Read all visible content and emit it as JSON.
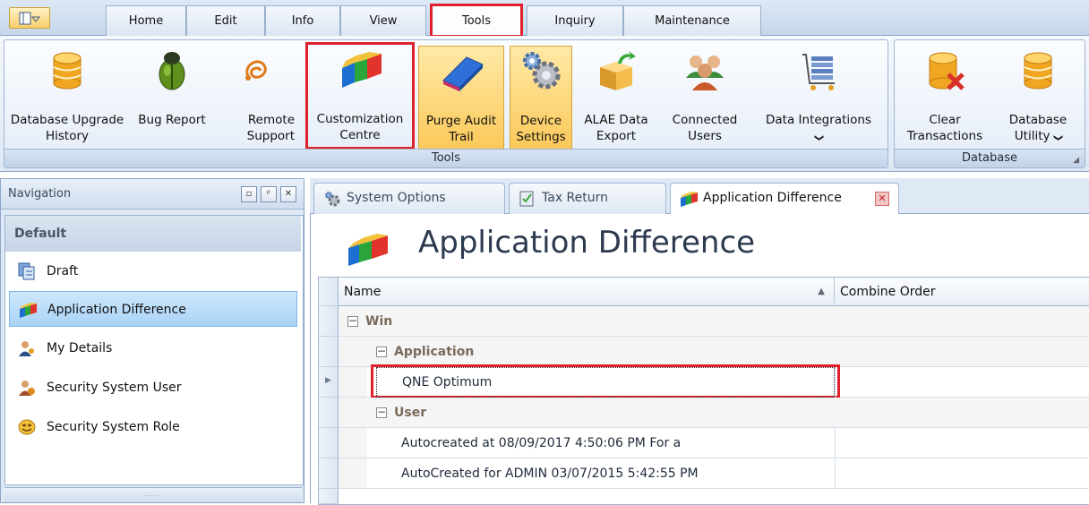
{
  "ribbon_tabs": [
    "Home",
    "Edit",
    "Info",
    "View",
    "Tools",
    "Inquiry",
    "Maintenance"
  ],
  "active_tab": "Tools",
  "tools_group": {
    "label": "Tools",
    "buttons": [
      {
        "label": "Database Upgrade History",
        "icon": "database-icon"
      },
      {
        "label": "Bug Report",
        "icon": "bug-icon"
      },
      {
        "label": "Remote Support",
        "icon": "remote-support-icon"
      },
      {
        "label": "Customization Centre",
        "icon": "customization-blocks-icon"
      },
      {
        "label": "Purge Audit Trail",
        "icon": "eraser-icon"
      },
      {
        "label": "Device Settings",
        "icon": "gears-icon"
      },
      {
        "label": "ALAE Data Export",
        "icon": "box-export-icon"
      },
      {
        "label": "Connected Users",
        "icon": "users-icon"
      },
      {
        "label": "Data Integrations",
        "icon": "cart-integration-icon",
        "dropdown": "❯"
      }
    ]
  },
  "database_group": {
    "label": "Database",
    "buttons": [
      {
        "label": "Clear Transactions",
        "icon": "database-clear-icon"
      },
      {
        "label": "Database Utility",
        "icon": "database-utility-icon",
        "dropdown": "❯"
      }
    ]
  },
  "navigation": {
    "title": "Navigation",
    "group": "Default",
    "items": [
      {
        "label": "Draft",
        "icon": "draft-icon"
      },
      {
        "label": "Application Difference",
        "icon": "customization-blocks-icon",
        "selected": true
      },
      {
        "label": "My Details",
        "icon": "user-icon"
      },
      {
        "label": "Security System User",
        "icon": "security-user-icon"
      },
      {
        "label": "Security System Role",
        "icon": "role-mask-icon"
      }
    ]
  },
  "doc_tabs": [
    {
      "label": "System Options",
      "icon": "gears-icon"
    },
    {
      "label": "Tax Return",
      "icon": "checklist-icon"
    },
    {
      "label": "Application Difference",
      "icon": "customization-blocks-icon",
      "active": true
    }
  ],
  "view": {
    "title": "Application Difference"
  },
  "grid": {
    "columns": [
      "Name",
      "Combine Order"
    ],
    "sort_glyph": "▲",
    "rows": [
      {
        "type": "group",
        "level": 0,
        "label": "Win"
      },
      {
        "type": "group",
        "level": 1,
        "label": "Application"
      },
      {
        "type": "data",
        "name": "QNE Optimum",
        "focused": true
      },
      {
        "type": "group",
        "level": 1,
        "label": "User"
      },
      {
        "type": "data",
        "name": "Autocreated at 08/09/2017 4:50:06 PM For a"
      },
      {
        "type": "data",
        "name": "AutoCreated for ADMIN 03/07/2015 5:42:55 PM"
      }
    ]
  },
  "colors": {
    "highlight_red": "#e0202a",
    "ribbon_hover": "#fbc95a",
    "selection_blue": "#a8d3f7"
  }
}
